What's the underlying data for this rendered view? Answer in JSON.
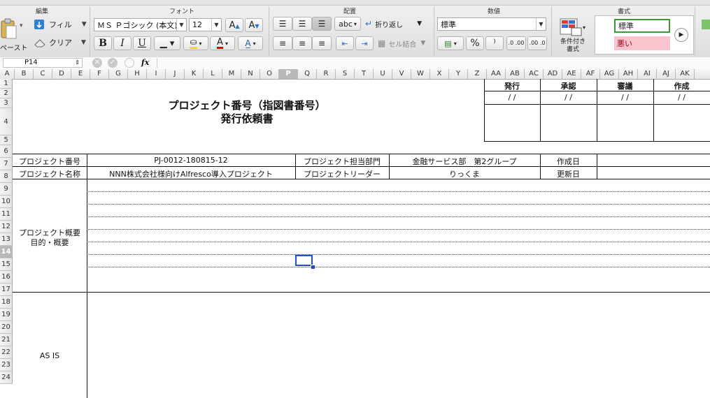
{
  "ribbon": {
    "groups": {
      "edit": "編集",
      "font": "フォント",
      "align": "配置",
      "number": "数値",
      "style": "書式"
    },
    "paste_label": "ペースト",
    "fill_label": "フィル",
    "clear_label": "クリア",
    "font_name": "ＭＳ Ｐゴシック (本文)",
    "font_size": "12",
    "bold": "B",
    "italic": "I",
    "underline": "U",
    "wrap_label": "折り返し",
    "merge_label": "セル結合",
    "abc_label": "abc",
    "number_format": "標準",
    "percent": "%",
    "comma": "⁾",
    "dec_inc": ".0 .00",
    "dec_dec": ".00 .0",
    "cond_format_label": "条件付き\n書式",
    "style_normal": "標準",
    "style_bad": "悪い"
  },
  "formula": {
    "cell_ref": "P14",
    "fx": "fx",
    "value": ""
  },
  "columns": [
    "A",
    "B",
    "C",
    "D",
    "E",
    "F",
    "G",
    "H",
    "I",
    "J",
    "K",
    "L",
    "M",
    "N",
    "O",
    "P",
    "Q",
    "R",
    "S",
    "T",
    "U",
    "V",
    "W",
    "X",
    "Y",
    "Z",
    "AA",
    "AB",
    "AC",
    "AD",
    "AE",
    "AF",
    "AG",
    "AH",
    "AI",
    "AJ",
    "AK"
  ],
  "rows": [
    "1",
    "2",
    "3",
    "4",
    "5",
    "6",
    "7",
    "8",
    "9",
    "10",
    "11",
    "12",
    "13",
    "14",
    "15",
    "16",
    "17",
    "18",
    "19",
    "20",
    "21",
    "22",
    "23",
    "24"
  ],
  "doc": {
    "title_line1": "プロジェクト番号（指図書番号）",
    "title_line2": "発行依頼書",
    "approval_headers": [
      "発行",
      "承認",
      "審議",
      "作成"
    ],
    "date_placeholder": "/ /",
    "labels": {
      "project_no": "プロジェクト番号",
      "project_name": "プロジェクト名称",
      "dept": "プロジェクト担当部門",
      "leader": "プロジェクトリーダー",
      "created": "作成日",
      "updated": "更新日",
      "overview_line1": "プロジェクト概要",
      "overview_line2": "目的・概要",
      "asis": "AS IS"
    },
    "values": {
      "project_no": "PJ-0012-180815-12",
      "project_name": "NNN株式会社様向けAlfresco導入プロジェクト",
      "dept": "金融サービス部　第2グループ",
      "leader": "りっくま",
      "created": "",
      "updated": ""
    }
  },
  "colors": {
    "selection": "#1f4fd6",
    "bad_bg": "#f9c4ce",
    "bad_text": "#9c0016",
    "good_border": "#3a9a3a"
  }
}
